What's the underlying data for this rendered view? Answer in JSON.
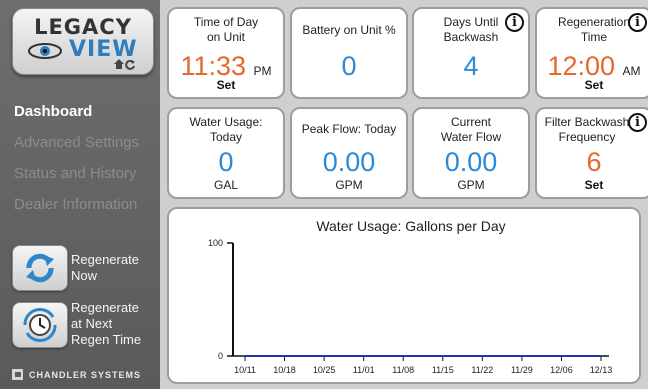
{
  "logo": {
    "line1": "LEGACY",
    "line2": "VIEW"
  },
  "sidebar": {
    "items": [
      {
        "label": "Dashboard"
      },
      {
        "label": "Advanced Settings"
      },
      {
        "label": "Status and History"
      },
      {
        "label": "Dealer Information"
      }
    ],
    "regen_now": {
      "line1": "Regenerate",
      "line2": "Now"
    },
    "regen_next": {
      "line1": "Regenerate",
      "line2": "at Next",
      "line3": "Regen Time"
    },
    "brand": "CHANDLER SYSTEMS"
  },
  "cards": {
    "time_of_day": {
      "title1": "Time of Day",
      "title2": "on Unit",
      "value": "11:33",
      "ampm": "PM",
      "action": "Set"
    },
    "battery": {
      "title": "Battery on Unit %",
      "value": "0"
    },
    "days_backwash": {
      "title1": "Days Until",
      "title2": "Backwash",
      "value": "4"
    },
    "regen_time": {
      "title1": "Regeneration",
      "title2": "Time",
      "value": "12:00",
      "ampm": "AM",
      "action": "Set"
    },
    "water_today": {
      "title1": "Water Usage:",
      "title2": "Today",
      "value": "0",
      "unit": "GAL"
    },
    "peak_flow": {
      "title": "Peak Flow: Today",
      "value": "0.00",
      "unit": "GPM"
    },
    "current_flow": {
      "title1": "Current",
      "title2": "Water Flow",
      "value": "0.00",
      "unit": "GPM"
    },
    "filter_freq": {
      "title1": "Filter Backwash",
      "title2": "Frequency",
      "value": "6",
      "action": "Set"
    }
  },
  "colors": {
    "accent_blue": "#2d8ad6",
    "accent_orange": "#e36a2a",
    "series_line": "#1f33b8",
    "sidebar_bg": "#5e5e5e"
  },
  "chart_data": {
    "type": "line",
    "title": "Water Usage: Gallons per Day",
    "xlabel": "",
    "ylabel": "",
    "ylim": [
      0,
      100
    ],
    "yticks": [
      0,
      100
    ],
    "xticks": [
      "10/11",
      "10/18",
      "10/25",
      "11/01",
      "11/08",
      "11/15",
      "11/22",
      "11/29",
      "12/06",
      "12/13"
    ],
    "series": [
      {
        "values": [
          0,
          0,
          0,
          0,
          0,
          0,
          0,
          0,
          0,
          0
        ]
      }
    ],
    "grid": false,
    "legend": "none"
  }
}
